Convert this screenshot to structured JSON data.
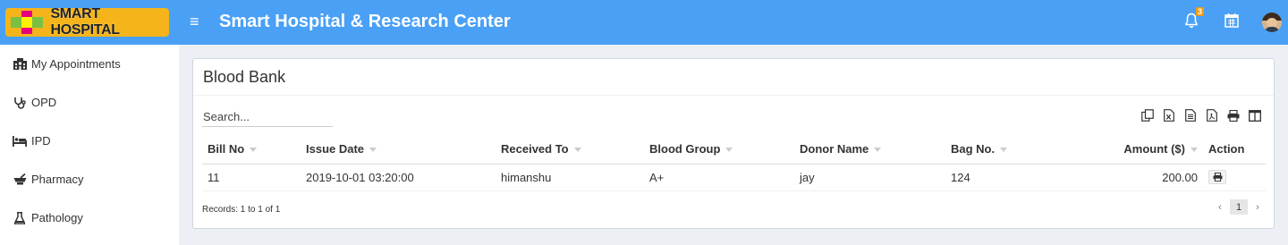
{
  "header": {
    "logo_text": "SMART HOSPITAL",
    "app_title": "Smart Hospital & Research Center",
    "notification_count": "3",
    "colors": {
      "topbar": "#4aa0f5",
      "logo_bg": "#f4b41a",
      "badge": "#f39c12"
    }
  },
  "sidebar": {
    "items": [
      {
        "label": "My Appointments",
        "icon": "hospital-icon"
      },
      {
        "label": "OPD",
        "icon": "stethoscope-icon"
      },
      {
        "label": "IPD",
        "icon": "bed-icon"
      },
      {
        "label": "Pharmacy",
        "icon": "mortar-icon"
      },
      {
        "label": "Pathology",
        "icon": "flask-icon"
      }
    ]
  },
  "main": {
    "title": "Blood Bank",
    "search": {
      "placeholder": "Search...",
      "value": ""
    },
    "table": {
      "columns": [
        "Bill No",
        "Issue Date",
        "Received To",
        "Blood Group",
        "Donor Name",
        "Bag No.",
        "Amount ($)",
        "Action"
      ],
      "rows": [
        {
          "bill_no": "11",
          "issue_date": "2019-10-01 03:20:00",
          "received_to": "himanshu",
          "blood_group": "A+",
          "donor_name": "jay",
          "bag_no": "124",
          "amount": "200.00"
        }
      ]
    },
    "records_text": "Records: 1 to 1 of 1",
    "pagination": {
      "prev": "‹",
      "current": "1",
      "next": "›"
    }
  }
}
